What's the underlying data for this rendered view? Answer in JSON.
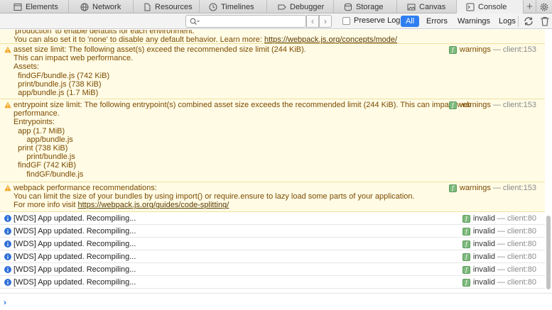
{
  "tabs": [
    {
      "label": "Elements",
      "icon": "elements-icon"
    },
    {
      "label": "Network",
      "icon": "network-icon"
    },
    {
      "label": "Resources",
      "icon": "resources-icon"
    },
    {
      "label": "Timelines",
      "icon": "timelines-icon"
    },
    {
      "label": "Debugger",
      "icon": "debugger-icon"
    },
    {
      "label": "Storage",
      "icon": "storage-icon"
    },
    {
      "label": "Canvas",
      "icon": "canvas-icon"
    },
    {
      "label": "Console",
      "icon": "console-icon",
      "active": true
    }
  ],
  "filterbar": {
    "search_placeholder": "",
    "preserve_log_label": "Preserve Log",
    "preserve_log_checked": false,
    "filters": [
      "All",
      "Errors",
      "Warnings",
      "Logs"
    ],
    "active_filter": "All"
  },
  "messages": {
    "m0": {
      "lines": [
        "'production' to enable defaults for each environment."
      ],
      "link_prefix": "You can also set it to 'none' to disable any default behavior. Learn more: ",
      "link": "https://webpack.js.org/concepts/mode/"
    },
    "m1": {
      "lines": [
        "asset size limit: The following asset(s) exceed the recommended size limit (244 KiB).",
        "This can impact web performance.",
        "Assets: ",
        "  findGF/bundle.js (742 KiB)",
        "  print/bundle.js (738 KiB)",
        "  app/bundle.js (1.7 MiB)"
      ],
      "source": "warnings",
      "location": "client:153"
    },
    "m2": {
      "lines": [
        "entrypoint size limit: The following entrypoint(s) combined asset size exceeds the recommended limit (244 KiB). This can impact web",
        "performance.",
        "Entrypoints:",
        "  app (1.7 MiB)",
        "      app/bundle.js",
        "  print (738 KiB)",
        "      print/bundle.js",
        "  findGF (742 KiB)",
        "      findGF/bundle.js"
      ],
      "source": "warnings",
      "location": "client:153"
    },
    "m3": {
      "lines": [
        "webpack performance recommendations: ",
        "You can limit the size of your bundles by using import() or require.ensure to lazy load some parts of your application."
      ],
      "link_prefix": "For more info visit ",
      "link": "https://webpack.js.org/guides/code-splitting/",
      "source": "warnings",
      "location": "client:153"
    },
    "info": [
      {
        "text": "[WDS] App updated. Recompiling...",
        "source": "invalid",
        "location": "client:80"
      },
      {
        "text": "[WDS] App updated. Recompiling...",
        "source": "invalid",
        "location": "client:80"
      },
      {
        "text": "[WDS] App updated. Recompiling...",
        "source": "invalid",
        "location": "client:80"
      },
      {
        "text": "[WDS] App updated. Recompiling...",
        "source": "invalid",
        "location": "client:80"
      },
      {
        "text": "[WDS] App updated. Recompiling...",
        "source": "invalid",
        "location": "client:80"
      },
      {
        "text": "[WDS] App updated. Recompiling...",
        "source": "invalid",
        "location": "client:80"
      }
    ]
  },
  "badge_letter": "f",
  "prompt_symbol": "›",
  "colors": {
    "warning_bg": "#fffbe5",
    "warning_text": "#7d4b00",
    "accent": "#2f7ff2",
    "info_icon": "#2f6fd8",
    "warning_icon": "#f5a623"
  }
}
